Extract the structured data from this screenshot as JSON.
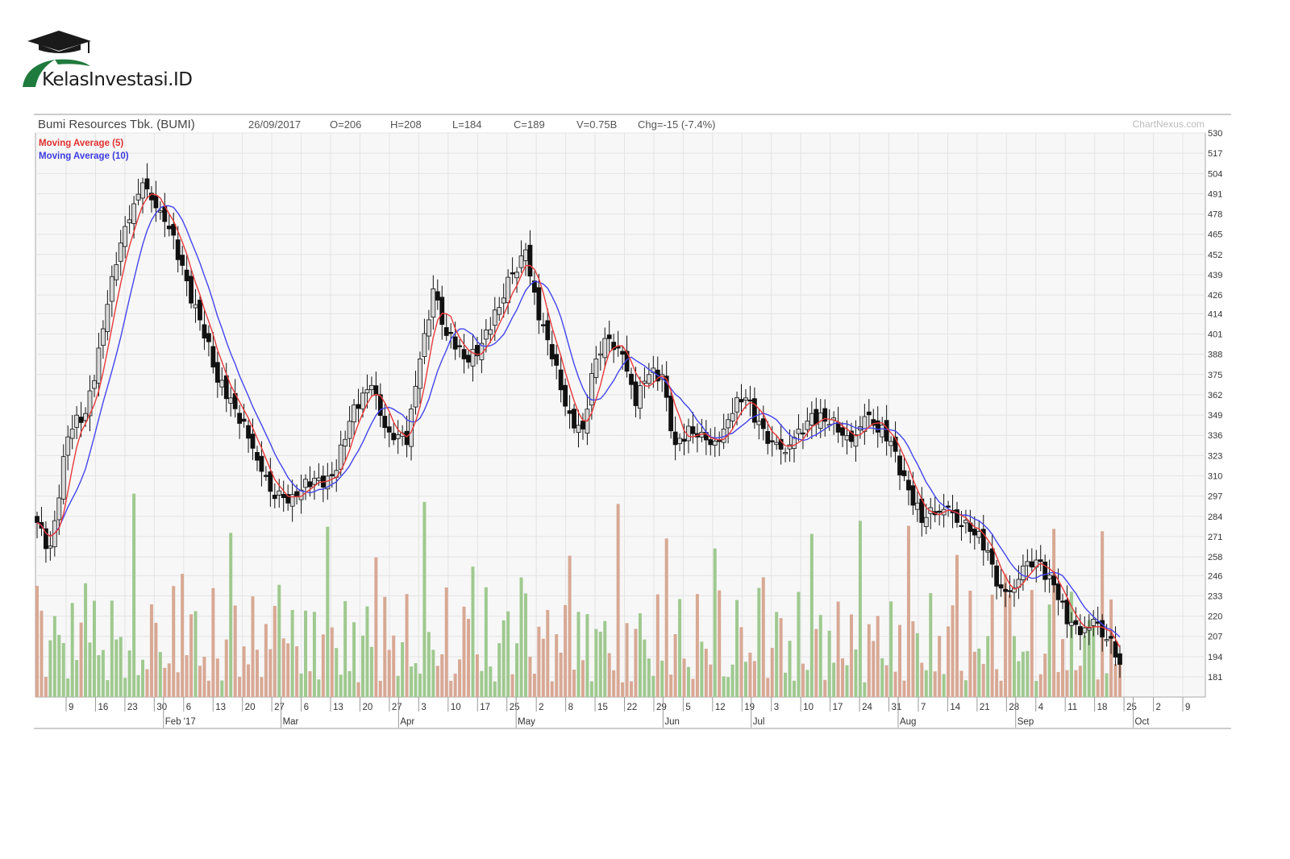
{
  "brand": {
    "logo_text": "KelasInvestasi.ID",
    "colors": {
      "green": "#1f7a3d",
      "dark": "#1a1a1a"
    }
  },
  "chart_data": {
    "type": "candlestick",
    "title": "Bumi Resources Tbk. (BUMI)",
    "header": {
      "date": "26/09/2017",
      "open": "O=206",
      "high": "H=208",
      "low": "L=184",
      "close": "C=189",
      "volume": "V=0.75B",
      "change": "Chg=-15 (-7.4%)"
    },
    "watermark": "ChartNexus.com",
    "legend": [
      {
        "name": "Moving Average (5)",
        "color": "#e83a3a"
      },
      {
        "name": "Moving Average (10)",
        "color": "#4040e8"
      }
    ],
    "ylim": [
      181,
      530
    ],
    "y_ticks": [
      530,
      517,
      504,
      491,
      478,
      465,
      452,
      439,
      426,
      414,
      401,
      388,
      375,
      362,
      349,
      336,
      323,
      310,
      297,
      284,
      271,
      258,
      246,
      233,
      220,
      207,
      194,
      181
    ],
    "x_tick_labels": [
      "9",
      "16",
      "23",
      "30",
      "6",
      "13",
      "20",
      "27",
      "6",
      "13",
      "20",
      "27",
      "3",
      "10",
      "17",
      "25",
      "2",
      "8",
      "15",
      "22",
      "29",
      "5",
      "12",
      "19",
      "3",
      "10",
      "17",
      "24",
      "31",
      "7",
      "14",
      "21",
      "28",
      "4",
      "11",
      "18",
      "25",
      "2",
      "9"
    ],
    "month_labels": [
      "Feb '17",
      "Mar",
      "Apr",
      "May",
      "Jun",
      "Jul",
      "Aug",
      "Sep",
      "Oct"
    ],
    "close_anchors": [
      [
        0,
        280
      ],
      [
        3,
        265
      ],
      [
        7,
        335
      ],
      [
        11,
        350
      ],
      [
        16,
        420
      ],
      [
        20,
        470
      ],
      [
        24,
        498
      ],
      [
        28,
        480
      ],
      [
        33,
        445
      ],
      [
        37,
        410
      ],
      [
        41,
        370
      ],
      [
        44,
        360
      ],
      [
        47,
        345
      ],
      [
        50,
        320
      ],
      [
        53,
        300
      ],
      [
        58,
        298
      ],
      [
        62,
        303
      ],
      [
        67,
        310
      ],
      [
        71,
        345
      ],
      [
        76,
        368
      ],
      [
        80,
        338
      ],
      [
        84,
        330
      ],
      [
        87,
        385
      ],
      [
        90,
        430
      ],
      [
        93,
        400
      ],
      [
        97,
        385
      ],
      [
        101,
        395
      ],
      [
        105,
        418
      ],
      [
        108,
        440
      ],
      [
        111,
        455
      ],
      [
        114,
        410
      ],
      [
        117,
        385
      ],
      [
        121,
        350
      ],
      [
        124,
        340
      ],
      [
        127,
        385
      ],
      [
        130,
        398
      ],
      [
        133,
        388
      ],
      [
        136,
        355
      ],
      [
        139,
        375
      ],
      [
        142,
        375
      ],
      [
        145,
        330
      ],
      [
        149,
        337
      ],
      [
        152,
        333
      ],
      [
        155,
        332
      ],
      [
        158,
        350
      ],
      [
        161,
        360
      ],
      [
        164,
        345
      ],
      [
        167,
        332
      ],
      [
        170,
        325
      ],
      [
        173,
        340
      ],
      [
        176,
        350
      ],
      [
        179,
        345
      ],
      [
        182,
        338
      ],
      [
        185,
        332
      ],
      [
        188,
        348
      ],
      [
        191,
        338
      ],
      [
        194,
        332
      ],
      [
        197,
        310
      ],
      [
        201,
        280
      ],
      [
        204,
        285
      ],
      [
        207,
        290
      ],
      [
        210,
        278
      ],
      [
        213,
        272
      ],
      [
        216,
        262
      ],
      [
        219,
        238
      ],
      [
        222,
        238
      ],
      [
        225,
        255
      ],
      [
        228,
        255
      ],
      [
        231,
        240
      ],
      [
        234,
        215
      ],
      [
        237,
        208
      ],
      [
        240,
        218
      ],
      [
        243,
        205
      ],
      [
        246,
        189
      ]
    ]
  }
}
